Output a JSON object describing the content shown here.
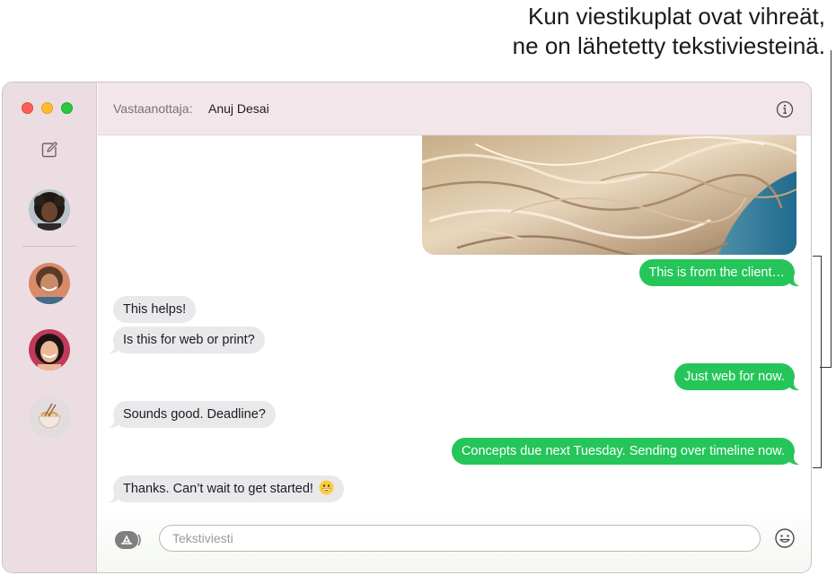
{
  "callout": {
    "line1": "Kun viestikuplat ovat vihreät,",
    "line2": "ne on lähetetty tekstiviesteinä."
  },
  "window": {
    "traffic_lights": [
      "close",
      "minimize",
      "zoom"
    ],
    "colors": {
      "close": "#ff5f57",
      "minimize": "#febc2e",
      "zoom": "#28c840"
    }
  },
  "sidebar": {
    "compose_icon": "compose-icon",
    "conversations": [
      {
        "icon": "avatar-person-1"
      },
      {
        "icon": "avatar-person-2"
      },
      {
        "icon": "avatar-person-3"
      },
      {
        "icon": "avatar-noodles"
      }
    ]
  },
  "header": {
    "to_label": "Vastaanottaja:",
    "recipient": "Anuj Desai",
    "info_icon": "info-icon"
  },
  "messages": [
    {
      "direction": "out",
      "type": "image",
      "description_icon": "hair-photo"
    },
    {
      "direction": "out",
      "text": "This is from the client…"
    },
    {
      "direction": "in",
      "text": "This helps!"
    },
    {
      "direction": "in",
      "text": "Is this for web or print?"
    },
    {
      "direction": "out",
      "text": "Just web for now."
    },
    {
      "direction": "in",
      "text": "Sounds good. Deadline?"
    },
    {
      "direction": "out",
      "text": "Concepts due next Tuesday. Sending over timeline now."
    },
    {
      "direction": "in",
      "text": "Thanks. Can’t wait to get started!",
      "emoji": "grinning-face"
    }
  ],
  "composer": {
    "placeholder": "Tekstiviesti",
    "value": "",
    "apps_icon": "app-store-icon",
    "emoji_icon": "emoji-icon"
  },
  "colors": {
    "sms_bubble": "#25c55a",
    "incoming_bubble": "#e9e8ea",
    "sidebar_bg": "#ecdde3"
  }
}
